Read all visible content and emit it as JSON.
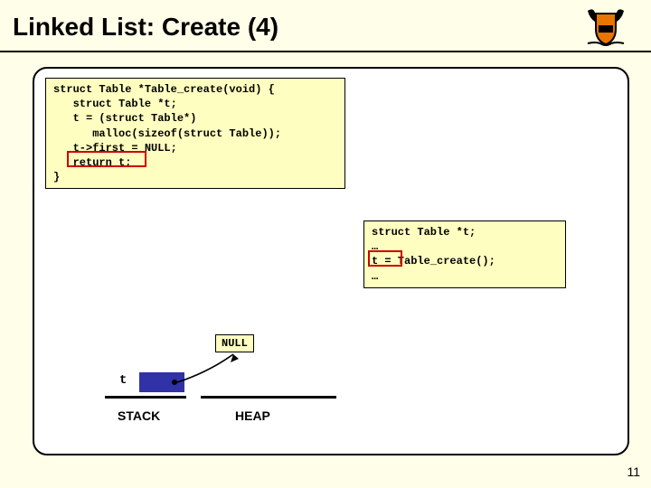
{
  "title": "Linked List: Create (4)",
  "code_left": "struct Table *Table_create(void) {\n   struct Table *t;\n   t = (struct Table*)\n      malloc(sizeof(struct Table));\n   t->first = NULL;\n   return t;\n}",
  "code_right": "struct Table *t;\n…\nt = Table_create();\n…",
  "null_label": "NULL",
  "var_label": "t",
  "stack_label": "STACK",
  "heap_label": "HEAP",
  "page_number": "11"
}
